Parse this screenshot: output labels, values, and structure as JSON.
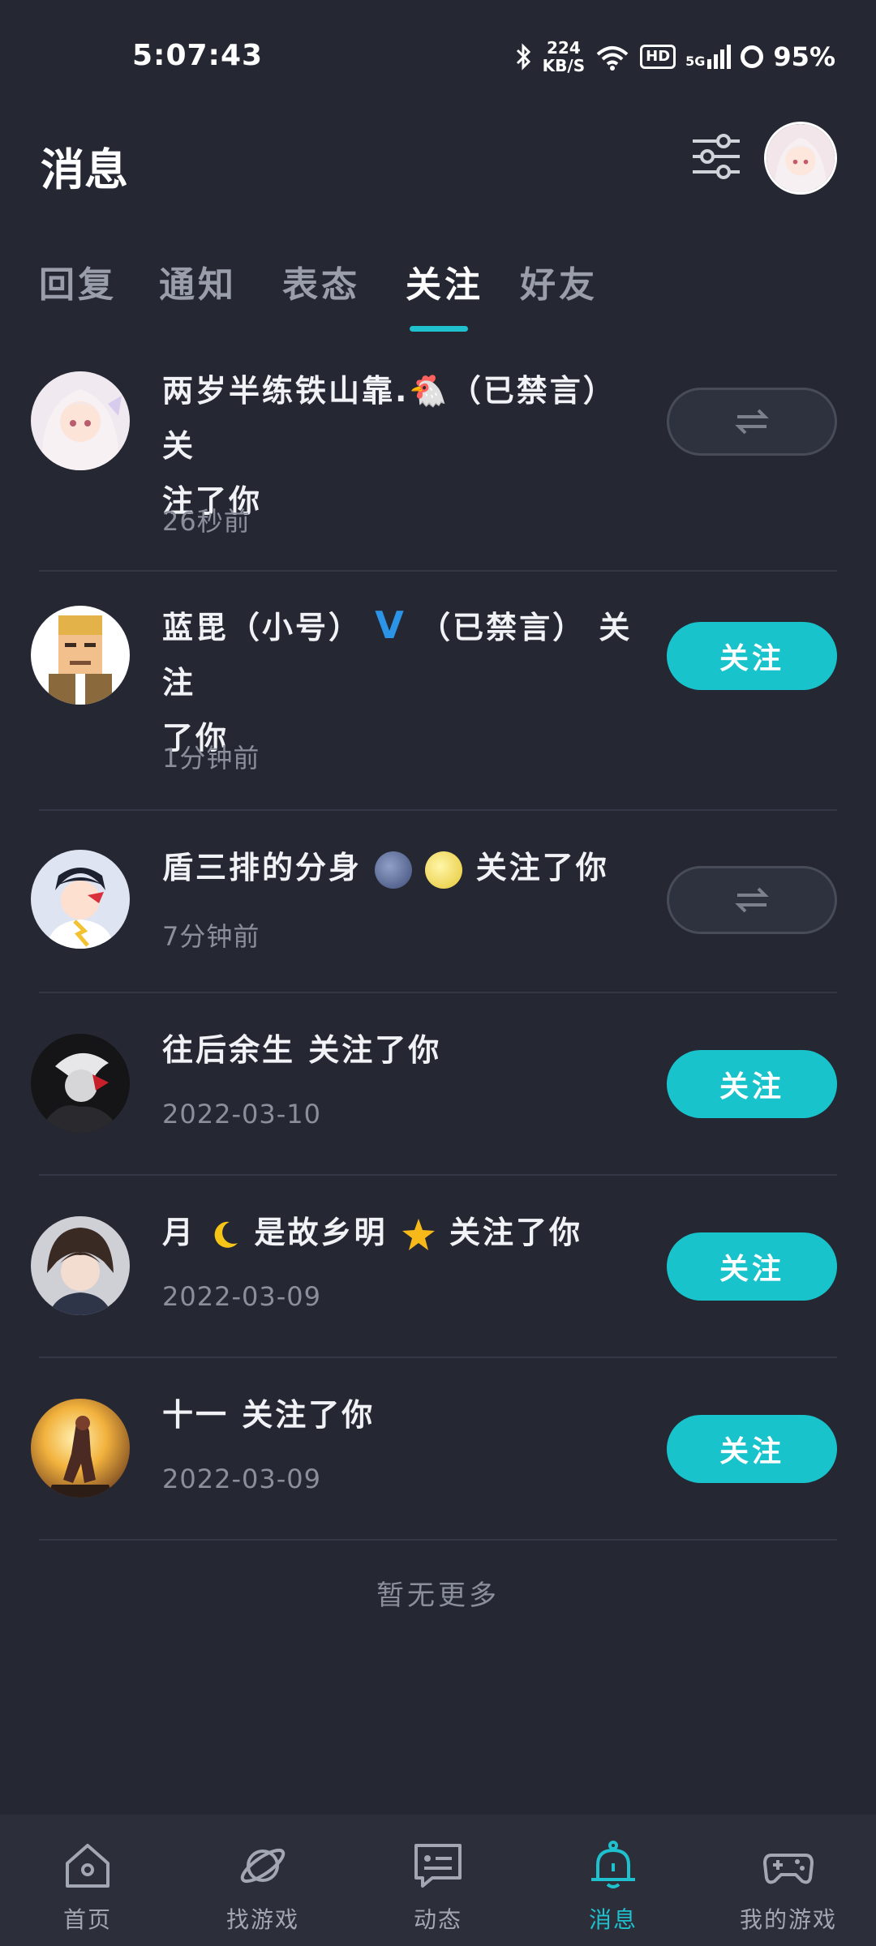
{
  "status_bar": {
    "time": "5:07:43",
    "net_speed_value": "224",
    "net_speed_unit": "KB/S",
    "hd": "HD",
    "signal": "5G",
    "battery": "95%"
  },
  "header": {
    "title": "消息",
    "filter_icon": "sliders-icon",
    "avatar": "avatar"
  },
  "tabs": [
    {
      "label": "回复",
      "active": false
    },
    {
      "label": "通知",
      "active": false
    },
    {
      "label": "表态",
      "active": false
    },
    {
      "label": "关注",
      "active": true
    },
    {
      "label": "好友",
      "active": false
    }
  ],
  "notifications": [
    {
      "line1": "两岁半练铁山靠.🐔（已禁言） 关",
      "line2": "注了你",
      "time": "26秒前",
      "button": "mutual"
    },
    {
      "name": "蓝毘（小号）",
      "badge": "V",
      "line1_rest": "（已禁言） 关注",
      "line2": "了你",
      "time": "1分钟前",
      "button": "关注"
    },
    {
      "name": "盾三排的分身",
      "line1_rest": "关注了你",
      "time": "7分钟前",
      "button": "mutual"
    },
    {
      "line1": "往后余生 关注了你",
      "time": "2022-03-10",
      "button": "关注"
    },
    {
      "name_part1": "月",
      "name_part2": "是故乡明",
      "line1_rest": "关注了你",
      "time": "2022-03-09",
      "button": "关注"
    },
    {
      "line1": "十一 关注了你",
      "time": "2022-03-09",
      "button": "关注"
    }
  ],
  "follow_label": "关注",
  "no_more": "暂无更多",
  "bottom_nav": [
    {
      "label": "首页",
      "icon": "home-icon"
    },
    {
      "label": "找游戏",
      "icon": "planet-icon"
    },
    {
      "label": "动态",
      "icon": "feed-icon"
    },
    {
      "label": "消息",
      "icon": "bell-icon",
      "active": true
    },
    {
      "label": "我的游戏",
      "icon": "gamepad-icon"
    }
  ],
  "colors": {
    "background": "#252833",
    "accent": "#18c3cc",
    "nav_background": "#2c2f3a"
  }
}
